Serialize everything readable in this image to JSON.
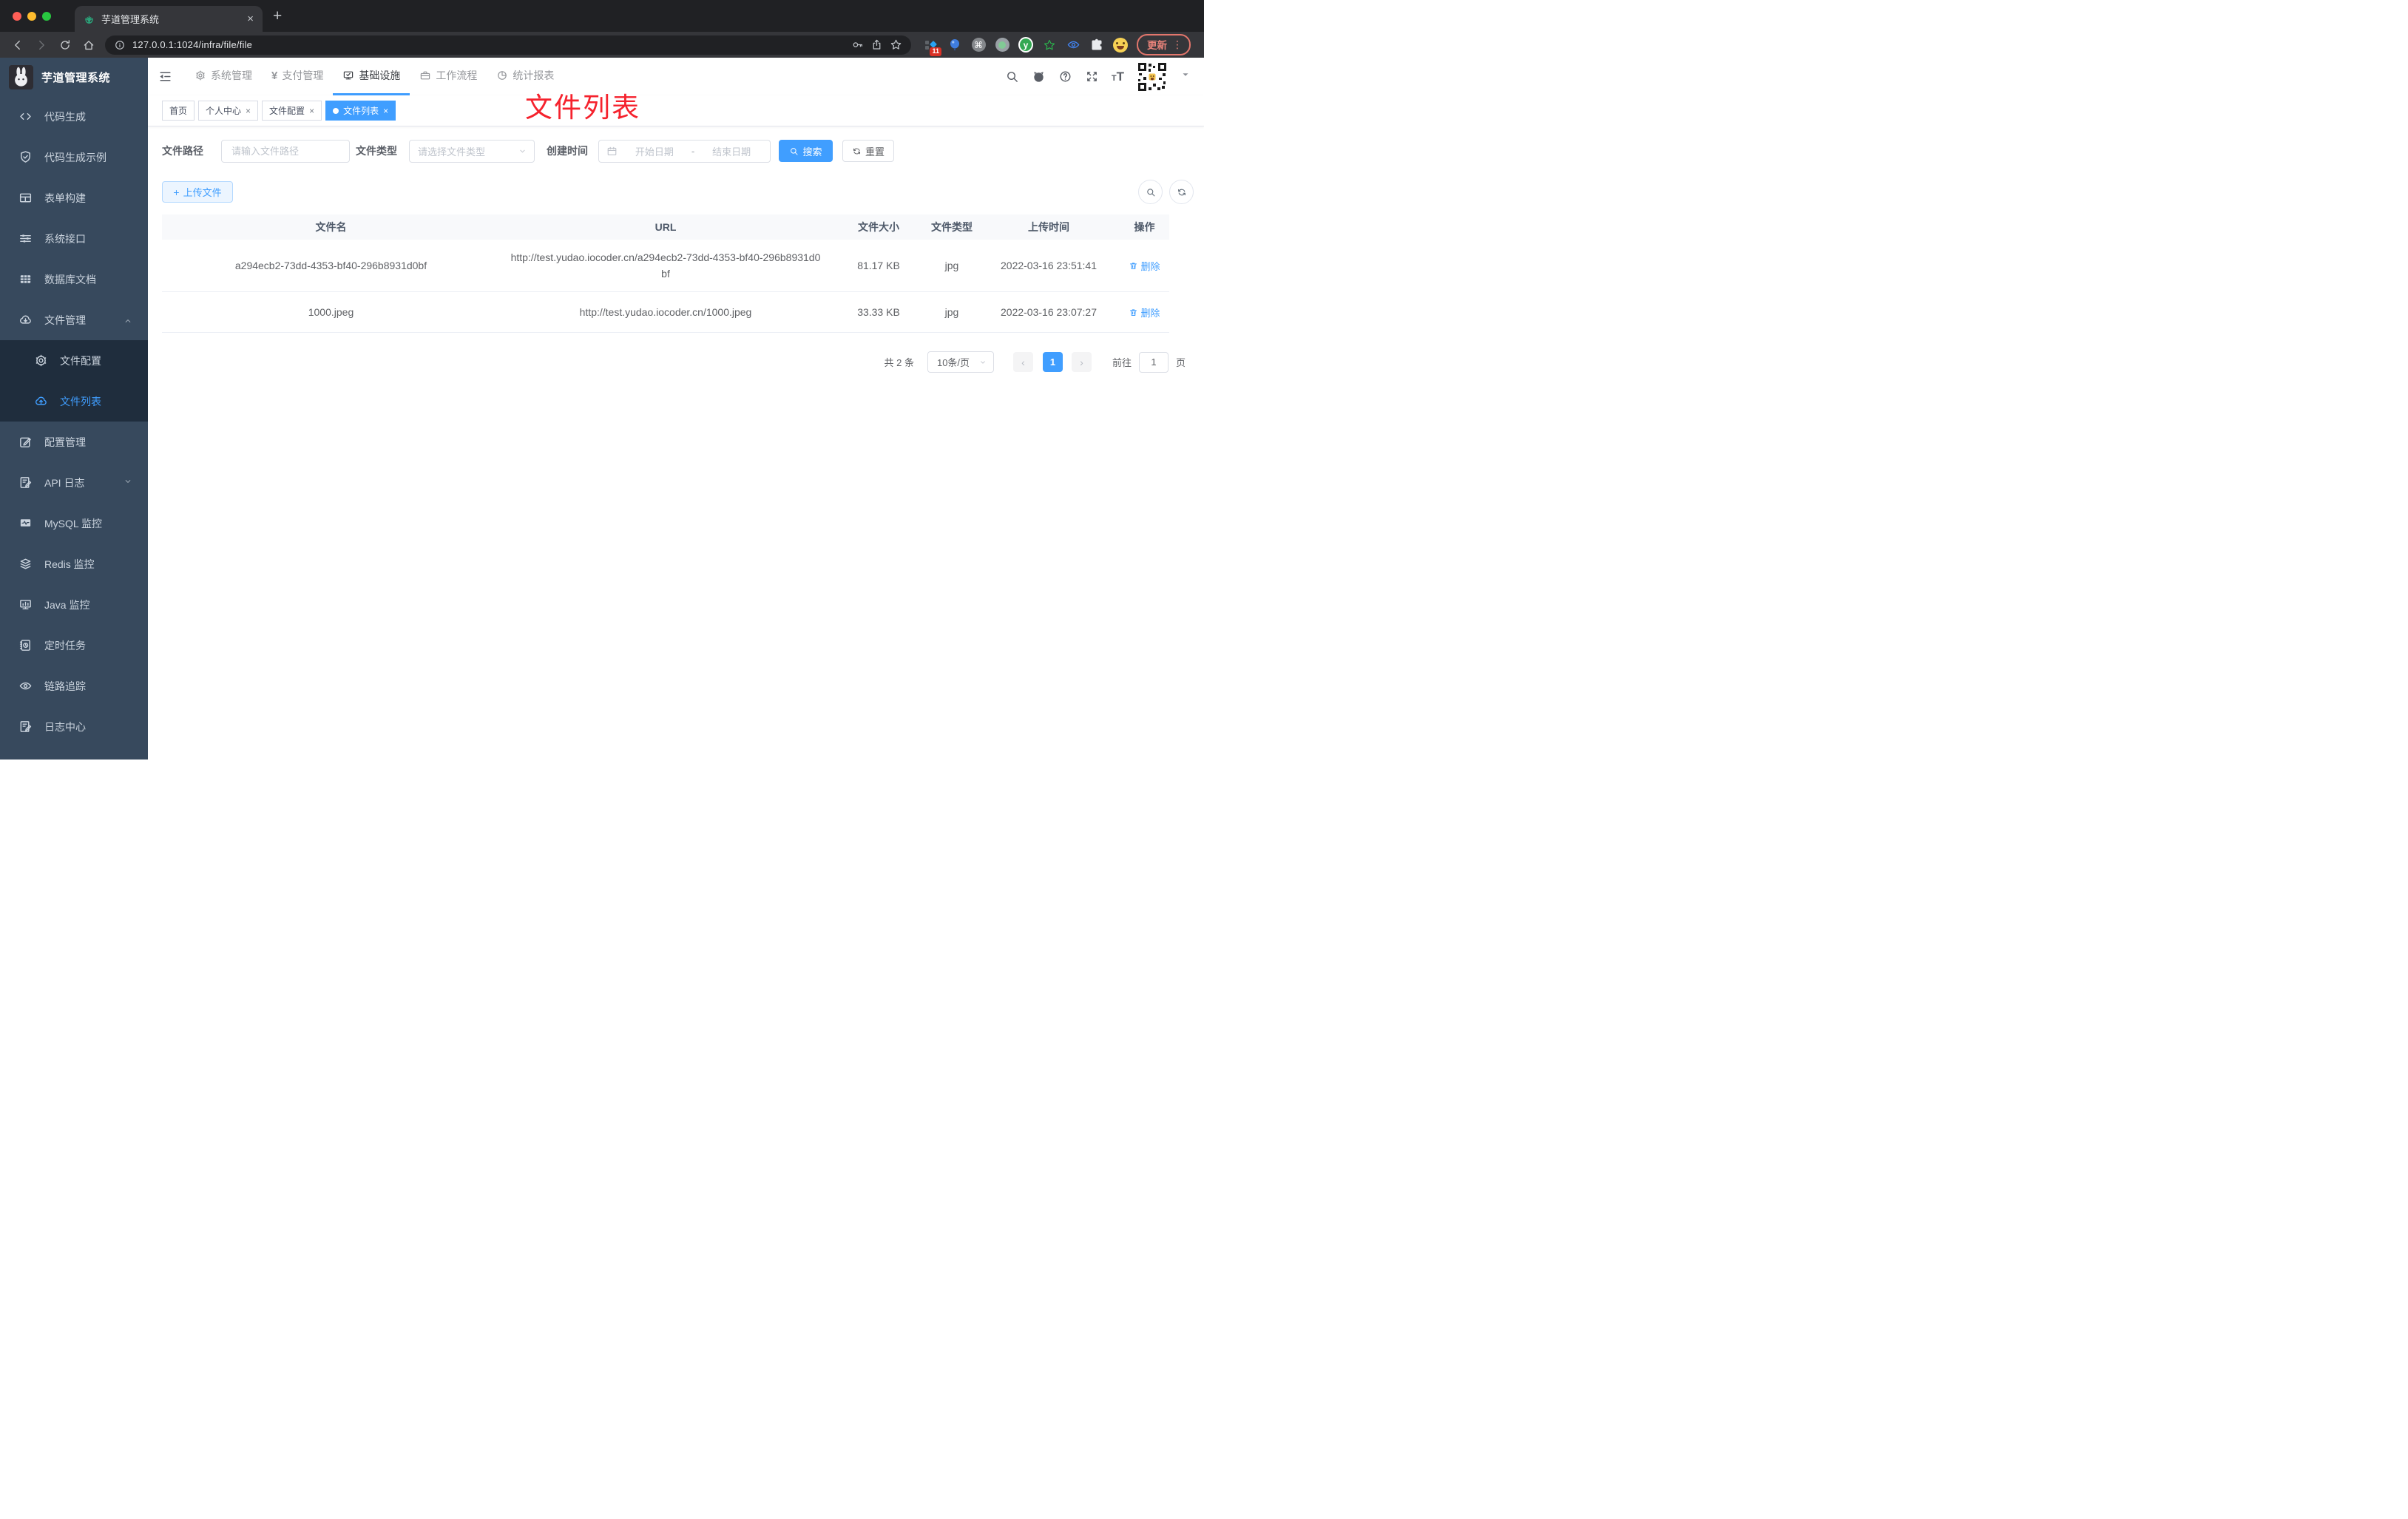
{
  "colors": {
    "primary": "#409eff",
    "annotation_red": "#f5222d",
    "update_button": "#e9837a",
    "badge_red": "#d93025",
    "sidebar_bg": "#37495d",
    "submenu_bg": "#1f2d3d"
  },
  "browser": {
    "tab_title": "芋道管理系统",
    "url": "127.0.0.1:1024/infra/file/file",
    "update_label": "更新",
    "extension_badge": "11",
    "glyphs": {
      "close": "×",
      "newtab": "+",
      "menu_dots": "⋮",
      "command": "⌘",
      "ext_y": "y"
    }
  },
  "sidebar": {
    "logo_title": "芋道管理系统",
    "items": [
      {
        "label": "代码生成",
        "icon": "code-icon"
      },
      {
        "label": "代码生成示例",
        "icon": "shield-check-icon"
      },
      {
        "label": "表单构建",
        "icon": "form-icon"
      },
      {
        "label": "系统接口",
        "icon": "sliders-icon"
      },
      {
        "label": "数据库文档",
        "icon": "database-grid-icon"
      },
      {
        "label": "文件管理",
        "icon": "cloud-download-icon"
      },
      {
        "label": "配置管理",
        "icon": "edit-square-icon"
      },
      {
        "label": "API 日志",
        "icon": "log-edit-icon"
      },
      {
        "label": "MySQL 监控",
        "icon": "monitor-pulse-icon"
      },
      {
        "label": "Redis 监控",
        "icon": "layers-icon"
      },
      {
        "label": "Java 监控",
        "icon": "monitor-bars-icon"
      },
      {
        "label": "定时任务",
        "icon": "schedule-icon"
      },
      {
        "label": "链路追踪",
        "icon": "eye-icon"
      },
      {
        "label": "日志中心",
        "icon": "log-edit-icon"
      }
    ],
    "submenu": [
      {
        "label": "文件配置",
        "icon": "gear-icon"
      },
      {
        "label": "文件列表",
        "icon": "cloud-upload-icon"
      }
    ]
  },
  "header": {
    "menu": [
      {
        "label": "系统管理",
        "icon": "gear-icon"
      },
      {
        "label": "支付管理",
        "icon": "yen-icon"
      },
      {
        "label": "基础设施",
        "icon": "monitor-check-icon"
      },
      {
        "label": "工作流程",
        "icon": "briefcase-icon"
      },
      {
        "label": "统计报表",
        "icon": "pie-chart-icon"
      }
    ],
    "yen_glyph": "¥",
    "font_small": "T",
    "font_large": "T"
  },
  "tags": [
    {
      "label": "首页"
    },
    {
      "label": "个人中心"
    },
    {
      "label": "文件配置"
    },
    {
      "label": "文件列表"
    }
  ],
  "tag_close_glyph": "×",
  "annotation": {
    "text": "文件列表"
  },
  "filter": {
    "path_label": "文件路径",
    "path_placeholder": "请输入文件路径",
    "type_label": "文件类型",
    "type_placeholder": "请选择文件类型",
    "time_label": "创建时间",
    "start_placeholder": "开始日期",
    "separator": "-",
    "end_placeholder": "结束日期",
    "search_label": "搜索",
    "reset_label": "重置"
  },
  "toolbar": {
    "upload_label": "上传文件",
    "plus_glyph": "+"
  },
  "table": {
    "headers": [
      "文件名",
      "URL",
      "文件大小",
      "文件类型",
      "上传时间",
      "操作"
    ],
    "rows": [
      {
        "name": "a294ecb2-73dd-4353-bf40-296b8931d0bf",
        "url": "http://test.yudao.iocoder.cn/a294ecb2-73dd-4353-bf40-296b8931d0bf",
        "size": "81.17 KB",
        "type": "jpg",
        "time": "2022-03-16 23:51:41",
        "action": "删除"
      },
      {
        "name": "1000.jpeg",
        "url": "http://test.yudao.iocoder.cn/1000.jpeg",
        "size": "33.33 KB",
        "type": "jpg",
        "time": "2022-03-16 23:07:27",
        "action": "删除"
      }
    ]
  },
  "pagination": {
    "total": "共 2 条",
    "page_size": "10条/页",
    "prev_glyph": "‹",
    "page": "1",
    "next_glyph": "›",
    "jump_label": "前往",
    "jump_value": "1",
    "page_unit": "页"
  }
}
